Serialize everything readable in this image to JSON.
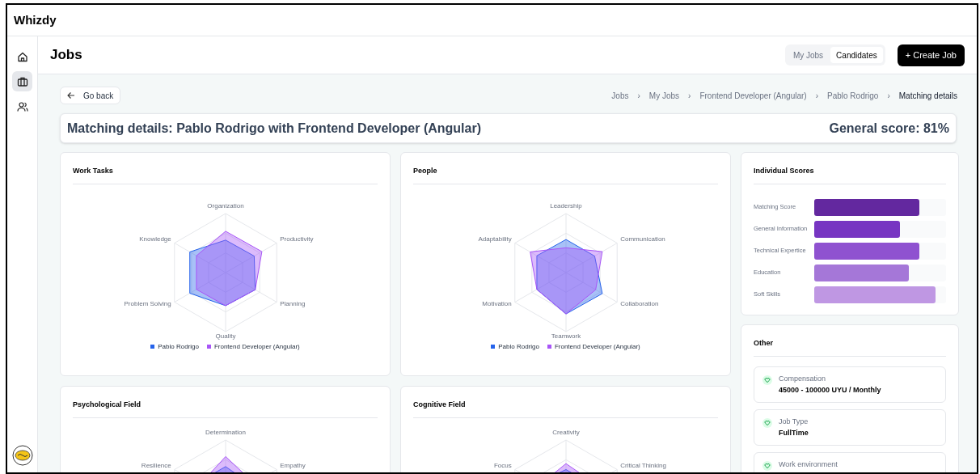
{
  "app": {
    "title": "Whizdy"
  },
  "sidebar": {
    "items": [
      {
        "kind": "home",
        "selected": false
      },
      {
        "kind": "jobs",
        "selected": true
      },
      {
        "kind": "people",
        "selected": false
      }
    ]
  },
  "header": {
    "title": "Jobs",
    "tabs": [
      {
        "label": "My Jobs",
        "selected": false
      },
      {
        "label": "Candidates",
        "selected": true
      }
    ],
    "create_button": "+ Create Job"
  },
  "back_button": "Go back",
  "breadcrumb": [
    {
      "kind": "link",
      "label": "Jobs"
    },
    {
      "kind": "separator",
      "label": "›"
    },
    {
      "kind": "link",
      "label": "My Jobs"
    },
    {
      "kind": "separator",
      "label": "›"
    },
    {
      "kind": "link",
      "label": "Frontend Developer (Angular)"
    },
    {
      "kind": "separator",
      "label": "›"
    },
    {
      "kind": "link",
      "label": "Pablo Rodrigo"
    },
    {
      "kind": "separator",
      "label": "›"
    },
    {
      "kind": "current",
      "label": "Matching details"
    }
  ],
  "heading": {
    "title": "Matching details: Pablo Rodrigo with Frontend Developer (Angular)",
    "score": "General score: 81%"
  },
  "radar_cards": [
    {
      "title": "Work Tasks",
      "axes": [
        "Organization",
        "Knowledge",
        "Productivity",
        "Problem Solving",
        "Planning",
        "Quality"
      ],
      "legend": [
        {
          "label": "Pablo Rodrigo",
          "color": "#2563eb"
        },
        {
          "label": "Frontend Developer (Angular)",
          "color": "#a855f7"
        }
      ]
    },
    {
      "title": "People",
      "axes": [
        "Leadership",
        "Adaptability",
        "Communication",
        "Motivation",
        "Collaboration",
        "Teamwork"
      ],
      "legend": [
        {
          "label": "Pablo Rodrigo",
          "color": "#2563eb"
        },
        {
          "label": "Frontend Developer (Angular)",
          "color": "#a855f7"
        }
      ]
    },
    {
      "title": "Psychological Field",
      "axes": [
        "Determination",
        "Resilience",
        "Empathy"
      ]
    },
    {
      "title": "Cognitive Field",
      "axes": [
        "Creativity",
        "Focus",
        "Critical Thinking"
      ]
    }
  ],
  "individual_scores": {
    "title": "Individual Scores",
    "rows": [
      {
        "label": "Matching Score",
        "level": 0.8,
        "color": "#63289f"
      },
      {
        "label": "General Information",
        "level": 0.65,
        "color": "#7735c2"
      },
      {
        "label": "Technical Expertice",
        "level": 0.8,
        "color": "#8f52d0"
      },
      {
        "label": "Education",
        "level": 0.72,
        "color": "#a577d8"
      },
      {
        "label": "Soft Skills",
        "level": 0.92,
        "color": "#bf97e3"
      }
    ]
  },
  "other": {
    "title": "Other",
    "items": [
      {
        "label": "Compensation",
        "value": "45000 - 100000 UYU / Monthly"
      },
      {
        "label": "Job Type",
        "value": "FullTime"
      },
      {
        "label": "Work environment"
      }
    ]
  }
}
